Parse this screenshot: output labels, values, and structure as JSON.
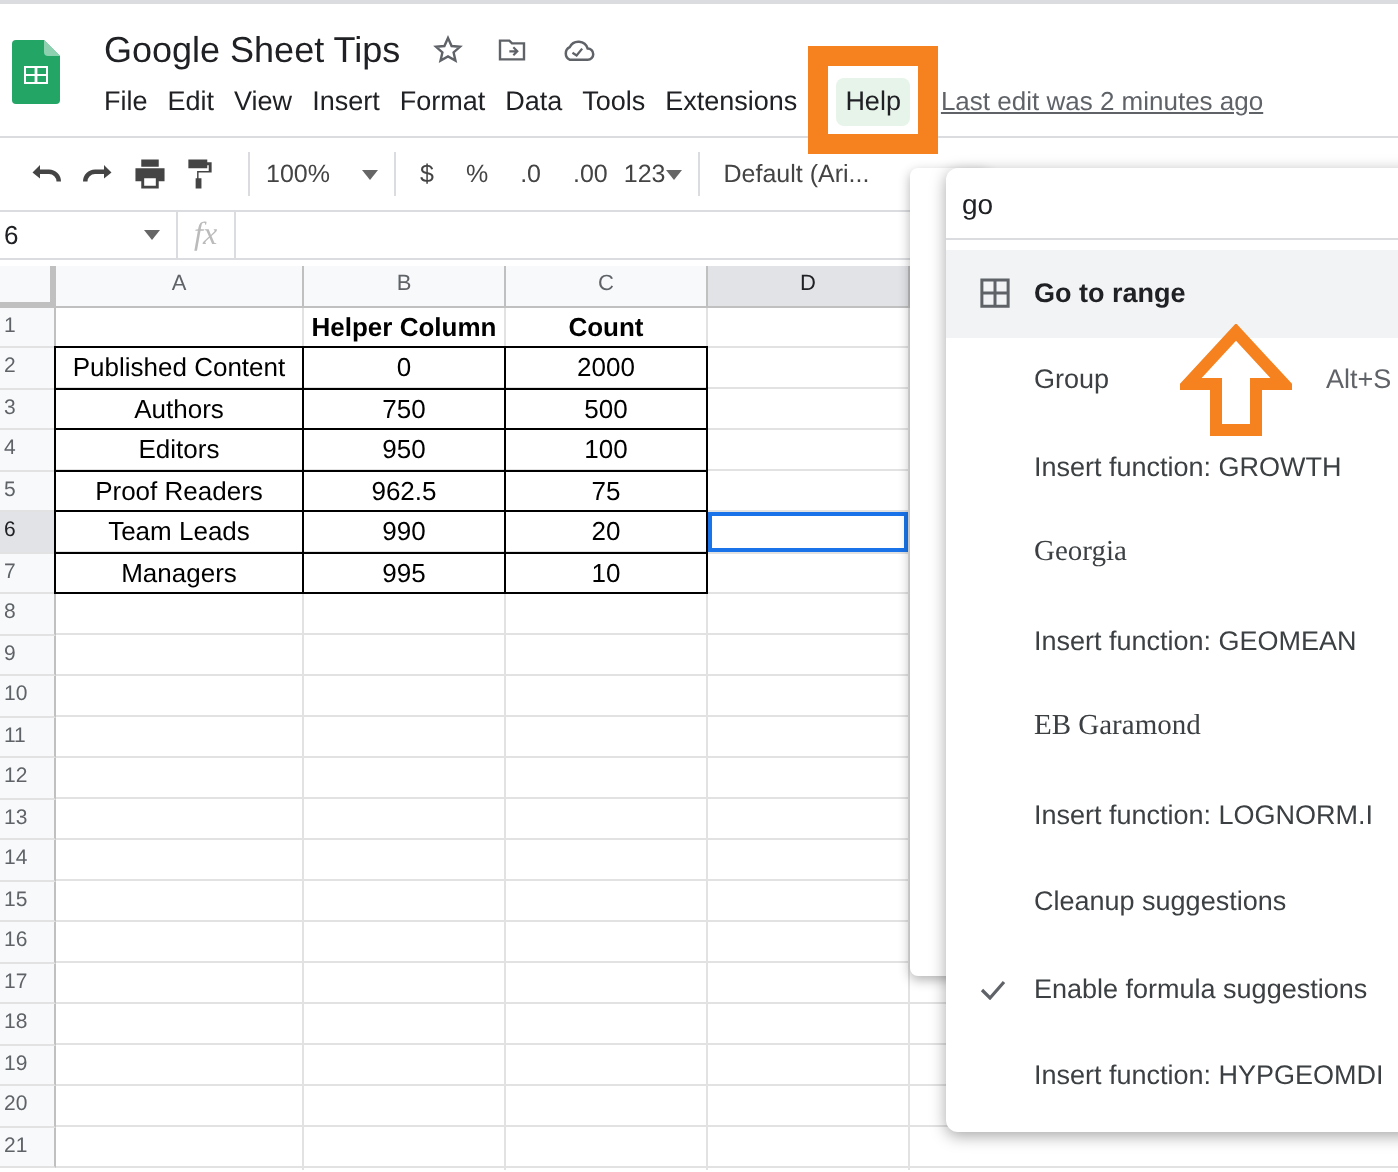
{
  "document": {
    "title": "Google Sheet Tips"
  },
  "menu_bar": [
    {
      "label": "File",
      "selected": false
    },
    {
      "label": "Edit",
      "selected": false
    },
    {
      "label": "View",
      "selected": false
    },
    {
      "label": "Insert",
      "selected": false
    },
    {
      "label": "Format",
      "selected": false
    },
    {
      "label": "Data",
      "selected": false
    },
    {
      "label": "Tools",
      "selected": false
    },
    {
      "label": "Extensions",
      "selected": false
    },
    {
      "label": "Help",
      "selected": true
    }
  ],
  "last_edit": "Last edit was 2 minutes ago",
  "toolbar": {
    "zoom": "100%",
    "currency": "$",
    "percent": "%",
    "decrease_decimals": ".0",
    "increase_decimals": ".00",
    "more_formats": "123",
    "font": "Default (Ari..."
  },
  "formula_bar": {
    "cell_reference": "6",
    "function_label": "fx"
  },
  "sheet": {
    "columns": [
      {
        "label": "A",
        "selected": false
      },
      {
        "label": "B",
        "selected": false
      },
      {
        "label": "C",
        "selected": false
      },
      {
        "label": "D",
        "selected": true
      }
    ],
    "row_headers": [
      {
        "label": "1",
        "selected": false
      },
      {
        "label": "2",
        "selected": false
      },
      {
        "label": "3",
        "selected": false
      },
      {
        "label": "4",
        "selected": false
      },
      {
        "label": "5",
        "selected": false
      },
      {
        "label": "6",
        "selected": true
      },
      {
        "label": "7",
        "selected": false
      },
      {
        "label": "8",
        "selected": false
      },
      {
        "label": "9",
        "selected": false
      },
      {
        "label": "10",
        "selected": false
      },
      {
        "label": "11",
        "selected": false
      },
      {
        "label": "12",
        "selected": false
      },
      {
        "label": "13",
        "selected": false
      },
      {
        "label": "14",
        "selected": false
      },
      {
        "label": "15",
        "selected": false
      },
      {
        "label": "16",
        "selected": false
      },
      {
        "label": "17",
        "selected": false
      },
      {
        "label": "18",
        "selected": false
      },
      {
        "label": "19",
        "selected": false
      },
      {
        "label": "20",
        "selected": false
      },
      {
        "label": "21",
        "selected": false
      }
    ],
    "table_header": [
      "Helper Column",
      "Count"
    ],
    "table_rows": [
      {
        "label": "Published Content",
        "helper": "0",
        "count": "2000"
      },
      {
        "label": "Authors",
        "helper": "750",
        "count": "500"
      },
      {
        "label": "Editors",
        "helper": "950",
        "count": "100"
      },
      {
        "label": "Proof Readers",
        "helper": "962.5",
        "count": "75"
      },
      {
        "label": "Team Leads",
        "helper": "990",
        "count": "20"
      },
      {
        "label": "Managers",
        "helper": "995",
        "count": "10"
      }
    ]
  },
  "search_menu": {
    "query": "go",
    "items": [
      {
        "label": "Go to range",
        "kind": "command",
        "selected": true,
        "checked": false
      },
      {
        "label": "Group",
        "kind": "command",
        "shortcut": "Alt+S",
        "selected": false,
        "checked": false
      },
      {
        "label": "Insert function: GROWTH",
        "kind": "command",
        "selected": false,
        "checked": false
      },
      {
        "label": "Georgia",
        "kind": "font",
        "selected": false,
        "checked": false
      },
      {
        "label": "Insert function: GEOMEAN",
        "kind": "command",
        "selected": false,
        "checked": false
      },
      {
        "label": "EB Garamond",
        "kind": "font",
        "selected": false,
        "checked": false
      },
      {
        "label": "Insert function: LOGNORM.I",
        "kind": "command",
        "selected": false,
        "checked": false
      },
      {
        "label": "Cleanup suggestions",
        "kind": "command",
        "selected": false,
        "checked": false
      },
      {
        "label": "Enable formula suggestions",
        "kind": "command",
        "selected": false,
        "checked": true
      },
      {
        "label": "Insert function: HYPGEOMDI",
        "kind": "command",
        "selected": false,
        "checked": false
      }
    ]
  },
  "annotations": {
    "highlight_frame": true,
    "arrow": true
  }
}
